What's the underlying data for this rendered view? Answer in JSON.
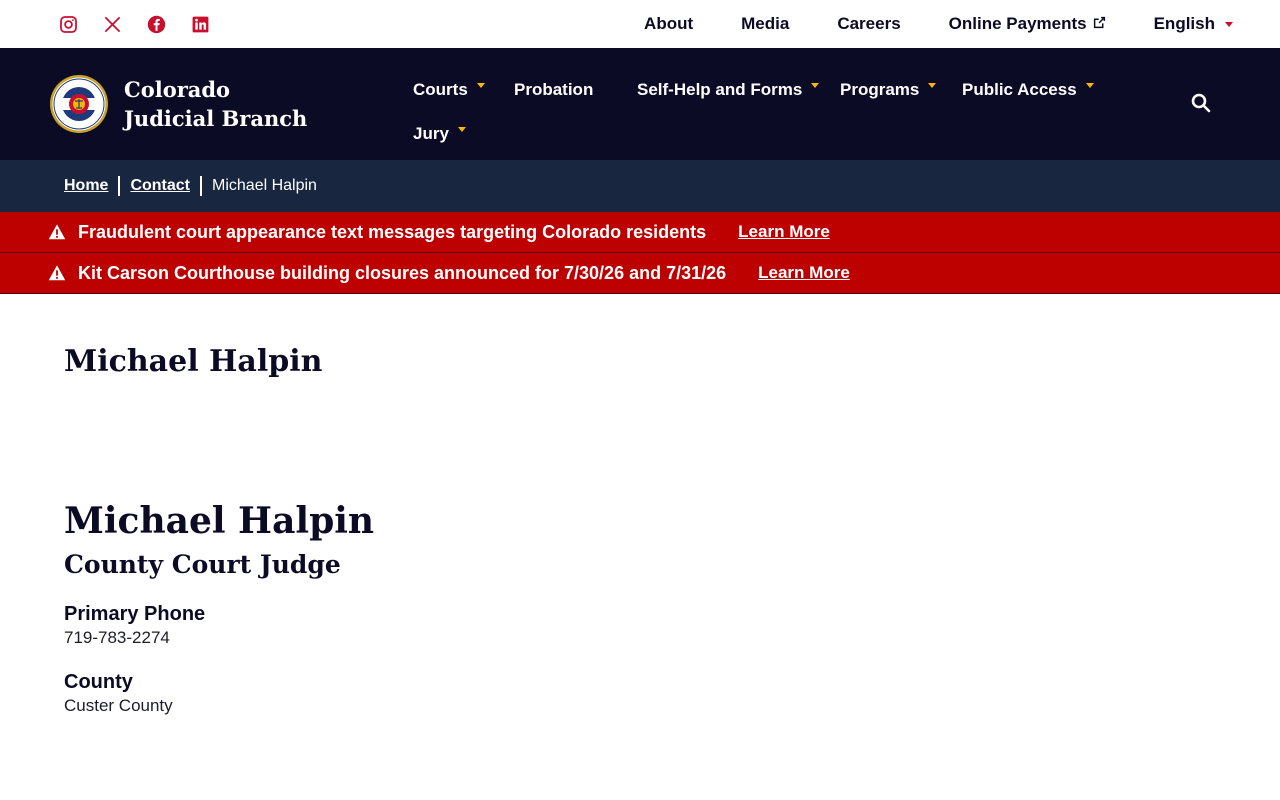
{
  "utility": {
    "socials": [
      "instagram-icon",
      "x-icon",
      "facebook-icon",
      "linkedin-icon"
    ],
    "links": {
      "about": "About",
      "media": "Media",
      "careers": "Careers",
      "payments": "Online Payments",
      "language": "English"
    }
  },
  "header": {
    "brand": "Colorado Judicial Branch",
    "nav": {
      "courts": "Courts",
      "probation": "Probation",
      "selfhelp": "Self-Help and Forms",
      "programs": "Programs",
      "public_access": "Public Access",
      "jury": "Jury"
    }
  },
  "breadcrumb": {
    "home": "Home",
    "contact": "Contact",
    "current": "Michael Halpin"
  },
  "alerts": [
    {
      "text": "Fraudulent court appearance text messages targeting Colorado residents",
      "link": "Learn More"
    },
    {
      "text": "Kit Carson Courthouse building closures announced for 7/30/26 and 7/31/26",
      "link": "Learn More"
    }
  ],
  "page": {
    "title": "Michael Halpin",
    "name": "Michael Halpin",
    "position": "County Court Judge",
    "phone_label": "Primary Phone",
    "phone": "719-783-2274",
    "county_label": "County",
    "county": "Custer County"
  },
  "colors": {
    "navy": "#0c0b26",
    "breadcrumb_bg": "#182640",
    "alert_red": "#bd0000",
    "accent_gold": "#f5b700",
    "social_red": "#c8102e"
  }
}
